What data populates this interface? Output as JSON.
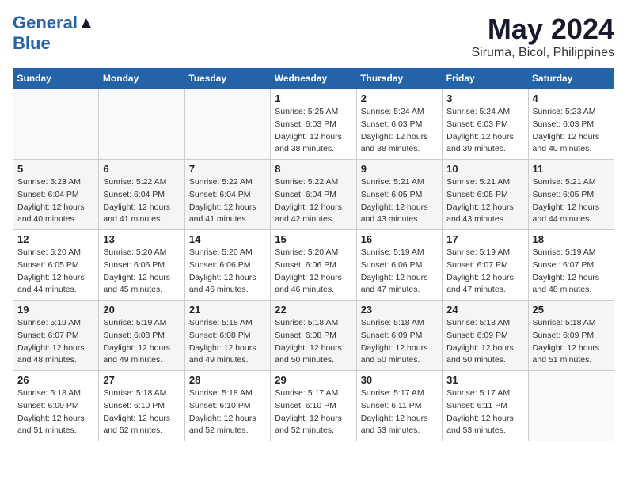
{
  "logo": {
    "line1_a": "General",
    "line1_b": "Blue",
    "line2": ""
  },
  "title": "May 2024",
  "subtitle": "Siruma, Bicol, Philippines",
  "headers": [
    "Sunday",
    "Monday",
    "Tuesday",
    "Wednesday",
    "Thursday",
    "Friday",
    "Saturday"
  ],
  "weeks": [
    [
      {
        "day": "",
        "info": ""
      },
      {
        "day": "",
        "info": ""
      },
      {
        "day": "",
        "info": ""
      },
      {
        "day": "1",
        "info": "Sunrise: 5:25 AM\nSunset: 6:03 PM\nDaylight: 12 hours\nand 38 minutes."
      },
      {
        "day": "2",
        "info": "Sunrise: 5:24 AM\nSunset: 6:03 PM\nDaylight: 12 hours\nand 38 minutes."
      },
      {
        "day": "3",
        "info": "Sunrise: 5:24 AM\nSunset: 6:03 PM\nDaylight: 12 hours\nand 39 minutes."
      },
      {
        "day": "4",
        "info": "Sunrise: 5:23 AM\nSunset: 6:03 PM\nDaylight: 12 hours\nand 40 minutes."
      }
    ],
    [
      {
        "day": "5",
        "info": "Sunrise: 5:23 AM\nSunset: 6:04 PM\nDaylight: 12 hours\nand 40 minutes."
      },
      {
        "day": "6",
        "info": "Sunrise: 5:22 AM\nSunset: 6:04 PM\nDaylight: 12 hours\nand 41 minutes."
      },
      {
        "day": "7",
        "info": "Sunrise: 5:22 AM\nSunset: 6:04 PM\nDaylight: 12 hours\nand 41 minutes."
      },
      {
        "day": "8",
        "info": "Sunrise: 5:22 AM\nSunset: 6:04 PM\nDaylight: 12 hours\nand 42 minutes."
      },
      {
        "day": "9",
        "info": "Sunrise: 5:21 AM\nSunset: 6:05 PM\nDaylight: 12 hours\nand 43 minutes."
      },
      {
        "day": "10",
        "info": "Sunrise: 5:21 AM\nSunset: 6:05 PM\nDaylight: 12 hours\nand 43 minutes."
      },
      {
        "day": "11",
        "info": "Sunrise: 5:21 AM\nSunset: 6:05 PM\nDaylight: 12 hours\nand 44 minutes."
      }
    ],
    [
      {
        "day": "12",
        "info": "Sunrise: 5:20 AM\nSunset: 6:05 PM\nDaylight: 12 hours\nand 44 minutes."
      },
      {
        "day": "13",
        "info": "Sunrise: 5:20 AM\nSunset: 6:06 PM\nDaylight: 12 hours\nand 45 minutes."
      },
      {
        "day": "14",
        "info": "Sunrise: 5:20 AM\nSunset: 6:06 PM\nDaylight: 12 hours\nand 46 minutes."
      },
      {
        "day": "15",
        "info": "Sunrise: 5:20 AM\nSunset: 6:06 PM\nDaylight: 12 hours\nand 46 minutes."
      },
      {
        "day": "16",
        "info": "Sunrise: 5:19 AM\nSunset: 6:06 PM\nDaylight: 12 hours\nand 47 minutes."
      },
      {
        "day": "17",
        "info": "Sunrise: 5:19 AM\nSunset: 6:07 PM\nDaylight: 12 hours\nand 47 minutes."
      },
      {
        "day": "18",
        "info": "Sunrise: 5:19 AM\nSunset: 6:07 PM\nDaylight: 12 hours\nand 48 minutes."
      }
    ],
    [
      {
        "day": "19",
        "info": "Sunrise: 5:19 AM\nSunset: 6:07 PM\nDaylight: 12 hours\nand 48 minutes."
      },
      {
        "day": "20",
        "info": "Sunrise: 5:19 AM\nSunset: 6:08 PM\nDaylight: 12 hours\nand 49 minutes."
      },
      {
        "day": "21",
        "info": "Sunrise: 5:18 AM\nSunset: 6:08 PM\nDaylight: 12 hours\nand 49 minutes."
      },
      {
        "day": "22",
        "info": "Sunrise: 5:18 AM\nSunset: 6:08 PM\nDaylight: 12 hours\nand 50 minutes."
      },
      {
        "day": "23",
        "info": "Sunrise: 5:18 AM\nSunset: 6:09 PM\nDaylight: 12 hours\nand 50 minutes."
      },
      {
        "day": "24",
        "info": "Sunrise: 5:18 AM\nSunset: 6:09 PM\nDaylight: 12 hours\nand 50 minutes."
      },
      {
        "day": "25",
        "info": "Sunrise: 5:18 AM\nSunset: 6:09 PM\nDaylight: 12 hours\nand 51 minutes."
      }
    ],
    [
      {
        "day": "26",
        "info": "Sunrise: 5:18 AM\nSunset: 6:09 PM\nDaylight: 12 hours\nand 51 minutes."
      },
      {
        "day": "27",
        "info": "Sunrise: 5:18 AM\nSunset: 6:10 PM\nDaylight: 12 hours\nand 52 minutes."
      },
      {
        "day": "28",
        "info": "Sunrise: 5:18 AM\nSunset: 6:10 PM\nDaylight: 12 hours\nand 52 minutes."
      },
      {
        "day": "29",
        "info": "Sunrise: 5:17 AM\nSunset: 6:10 PM\nDaylight: 12 hours\nand 52 minutes."
      },
      {
        "day": "30",
        "info": "Sunrise: 5:17 AM\nSunset: 6:11 PM\nDaylight: 12 hours\nand 53 minutes."
      },
      {
        "day": "31",
        "info": "Sunrise: 5:17 AM\nSunset: 6:11 PM\nDaylight: 12 hours\nand 53 minutes."
      },
      {
        "day": "",
        "info": ""
      }
    ]
  ]
}
